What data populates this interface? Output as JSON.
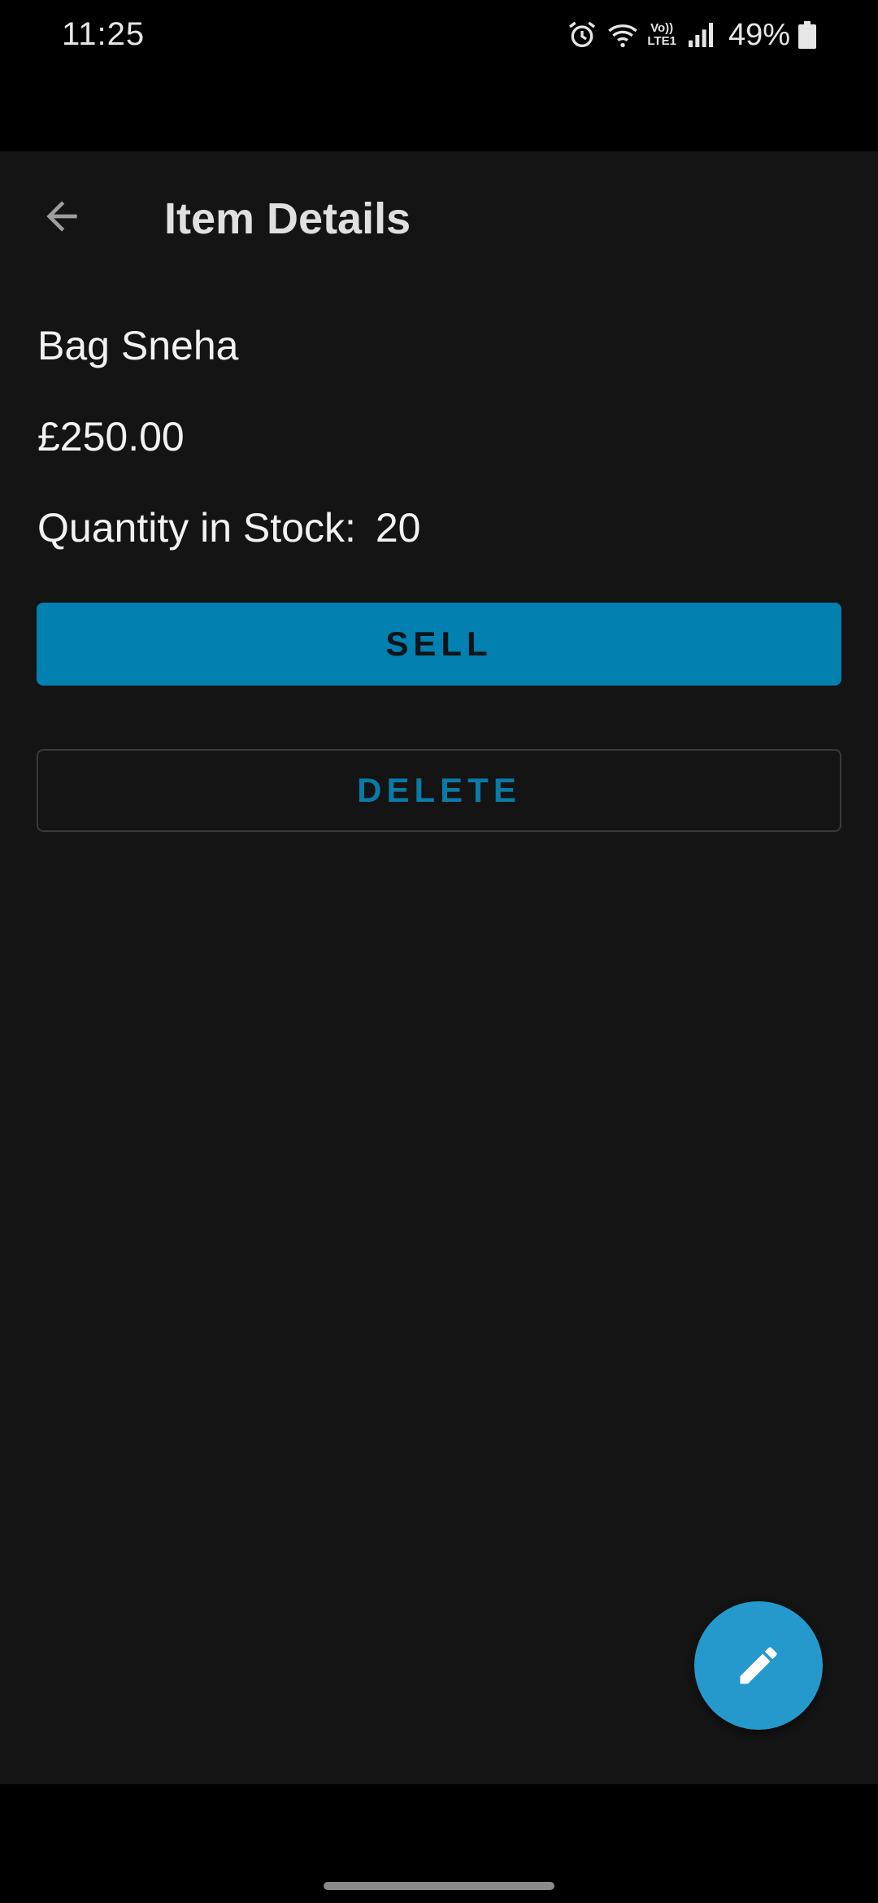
{
  "status_bar": {
    "time": "11:25",
    "network_top": "Vo))",
    "network_bottom": "LTE1",
    "battery_percent": "49%",
    "icons": [
      "alarm-icon",
      "wifi-icon",
      "volte-icon",
      "signal-icon",
      "battery-icon"
    ]
  },
  "toolbar": {
    "title": "Item Details",
    "back_icon": "arrow-back-icon"
  },
  "item": {
    "name": "Bag Sneha",
    "price": "£250.00",
    "stock_label": "Quantity in Stock:",
    "stock_value": "20"
  },
  "actions": {
    "sell_label": "SELL",
    "delete_label": "DELETE",
    "edit_icon": "edit-pencil-icon"
  },
  "colors": {
    "background": "#141414",
    "primary": "#0280b0",
    "delete_text": "#0a7aa6",
    "fab": "#2599cc"
  }
}
